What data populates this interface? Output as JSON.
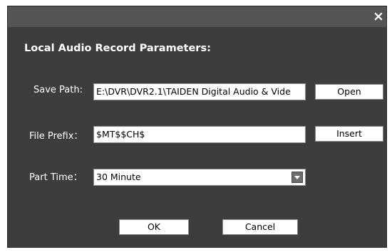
{
  "window": {
    "close_glyph": "×"
  },
  "heading": "Local Audio Record Parameters:",
  "save_path": {
    "label": "Save Path:",
    "value": "E:\\DVR\\DVR2.1\\TAIDEN Digital Audio & Vide",
    "button": "Open"
  },
  "file_prefix": {
    "label": "File Prefix：",
    "value": "$MT$$CH$",
    "button": "Insert"
  },
  "part_time": {
    "label": "Part Time：",
    "selected": "30 Minute"
  },
  "actions": {
    "ok": "OK",
    "cancel": "Cancel"
  },
  "colors": {
    "dialog_bg": "#3d3d3d",
    "titlebar_bg": "#555555",
    "text": "#ffffff"
  },
  "icons": {
    "close": "close-icon",
    "dropdown": "chevron-down-icon"
  }
}
